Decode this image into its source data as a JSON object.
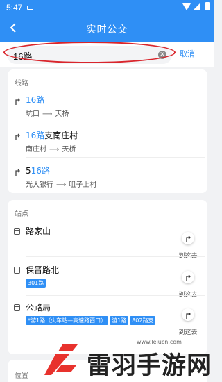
{
  "status_bar": {
    "time": "5:47"
  },
  "header": {
    "title": "实时公交",
    "back_icon": "back-arrow-icon"
  },
  "search": {
    "value": "16路",
    "cancel_label": "取消",
    "clear_icon": "clear-circle-icon"
  },
  "lines": {
    "section_label": "线路",
    "items": [
      {
        "name_prefix": "",
        "name_highlight": "16路",
        "name_suffix": "",
        "from": "坑口",
        "to": "天桥"
      },
      {
        "name_prefix": "",
        "name_highlight": "16路",
        "name_suffix": "支南庄村",
        "from": "南庄村",
        "to": "天桥"
      },
      {
        "name_prefix": "5",
        "name_highlight": "16路",
        "name_suffix": "",
        "from": "光大银行",
        "to": "咀子上村"
      }
    ]
  },
  "stops": {
    "section_label": "站点",
    "go_label": "到这去",
    "items": [
      {
        "name": "路家山",
        "tags": []
      },
      {
        "name": "保晋路北",
        "tags": [
          "301路"
        ]
      },
      {
        "name": "公路局",
        "tags": [
          "*游1路（火车站—高速路西口）",
          "游1路",
          "802路支"
        ]
      }
    ]
  },
  "position": {
    "section_label": "位置"
  },
  "watermark": {
    "brand": "雷羽手游网",
    "domain": "www.leiucn.com"
  },
  "colors": {
    "primary": "#2f8ff5",
    "highlight_oval": "#d9252c"
  }
}
